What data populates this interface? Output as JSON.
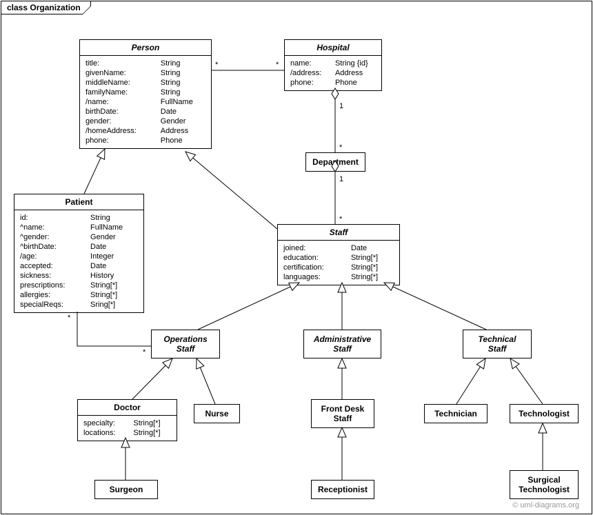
{
  "frame": {
    "title": "class Organization"
  },
  "classes": {
    "person": {
      "title": "Person",
      "rows": [
        [
          "title:",
          "String"
        ],
        [
          "givenName:",
          "String"
        ],
        [
          "middleName:",
          "String"
        ],
        [
          "familyName:",
          "String"
        ],
        [
          "/name:",
          "FullName"
        ],
        [
          "birthDate:",
          "Date"
        ],
        [
          "gender:",
          "Gender"
        ],
        [
          "/homeAddress:",
          "Address"
        ],
        [
          "phone:",
          "Phone"
        ]
      ]
    },
    "hospital": {
      "title": "Hospital",
      "rows": [
        [
          "name:",
          "String {id}"
        ],
        [
          "/address:",
          "Address"
        ],
        [
          "phone:",
          "Phone"
        ]
      ]
    },
    "department": {
      "title": "Department"
    },
    "patient": {
      "title": "Patient",
      "rows": [
        [
          "id:",
          "String"
        ],
        [
          "^name:",
          "FullName"
        ],
        [
          "^gender:",
          "Gender"
        ],
        [
          "^birthDate:",
          "Date"
        ],
        [
          "/age:",
          "Integer"
        ],
        [
          "accepted:",
          "Date"
        ],
        [
          "sickness:",
          "History"
        ],
        [
          "prescriptions:",
          "String[*]"
        ],
        [
          "allergies:",
          "String[*]"
        ],
        [
          "specialReqs:",
          "Sring[*]"
        ]
      ]
    },
    "staff": {
      "title": "Staff",
      "rows": [
        [
          "joined:",
          "Date"
        ],
        [
          "education:",
          "String[*]"
        ],
        [
          "certification:",
          "String[*]"
        ],
        [
          "languages:",
          "String[*]"
        ]
      ]
    },
    "operations": {
      "title": "Operations",
      "subtitle": "Staff"
    },
    "administrative": {
      "title": "Administrative",
      "subtitle": "Staff"
    },
    "technical": {
      "title": "Technical",
      "subtitle": "Staff"
    },
    "doctor": {
      "title": "Doctor",
      "rows": [
        [
          "specialty:",
          "String[*]"
        ],
        [
          "locations:",
          "String[*]"
        ]
      ]
    },
    "nurse": {
      "title": "Nurse"
    },
    "frontdesk": {
      "title": "Front Desk",
      "subtitle": "Staff"
    },
    "technician": {
      "title": "Technician"
    },
    "technologist": {
      "title": "Technologist"
    },
    "surgeon": {
      "title": "Surgeon"
    },
    "receptionist": {
      "title": "Receptionist"
    },
    "surgtech": {
      "title": "Surgical",
      "subtitle": "Technologist"
    }
  },
  "mult": {
    "personHosp1": "*",
    "personHosp2": "*",
    "hospDept1": "1",
    "hospDept2": "*",
    "deptStaff1": "1",
    "deptStaff2": "*",
    "patOps1": "*",
    "patOps2": "*"
  },
  "watermark": "© uml-diagrams.org"
}
